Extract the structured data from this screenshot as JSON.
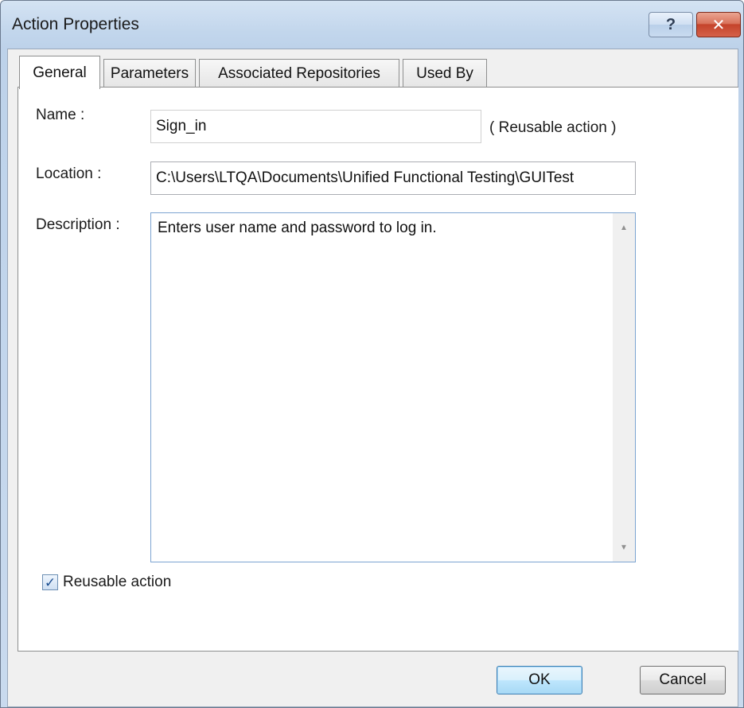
{
  "window": {
    "title": "Action Properties",
    "help_label": "?",
    "close_label": "✕"
  },
  "tabs": [
    {
      "label": "General",
      "active": true
    },
    {
      "label": "Parameters",
      "active": false
    },
    {
      "label": "Associated Repositories",
      "active": false
    },
    {
      "label": "Used By",
      "active": false
    }
  ],
  "general": {
    "name_label": "Name :",
    "name_value": "Sign_in",
    "name_note": "( Reusable action )",
    "location_label": "Location :",
    "location_value": "C:\\Users\\LTQA\\Documents\\Unified Functional Testing\\GUITest",
    "description_label": "Description :",
    "description_value": "Enters user name and password to log in.",
    "reusable_checked": true,
    "reusable_label": "Reusable action"
  },
  "buttons": {
    "ok": "OK",
    "cancel": "Cancel"
  },
  "colors": {
    "titlebar": "#c2d6ec",
    "close_button": "#c4432b",
    "ok_button": "#bee6fd"
  },
  "icons": {
    "help": "help-icon",
    "close": "close-icon",
    "check": "checkmark-icon",
    "scroll_up": "scroll-up-arrow-icon",
    "scroll_down": "scroll-down-arrow-icon"
  }
}
